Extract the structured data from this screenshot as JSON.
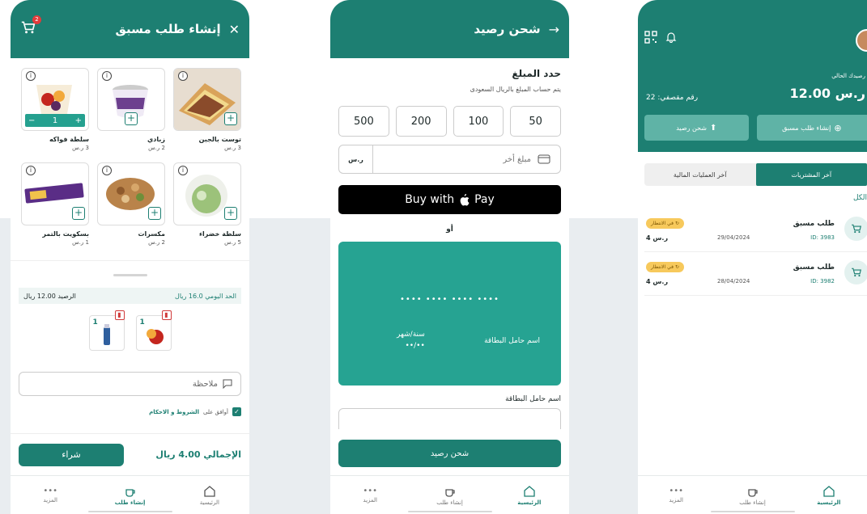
{
  "colors": {
    "primary": "#1d7f72",
    "card": "#26a392",
    "pending": "#f7c95c"
  },
  "nav": {
    "home": "الرئيسية",
    "create": "إنشاء طلب",
    "more": "المزيد"
  },
  "screen1": {
    "title": "إنشاء طلب مسبق",
    "cart_count": "2",
    "products": [
      {
        "name": "توست بالجبن",
        "price": "3 ر.س",
        "control": "add"
      },
      {
        "name": "زبادي",
        "price": "2 ر.س",
        "control": "add"
      },
      {
        "name": "سلطة فواكه",
        "price": "3 ر.س",
        "control": "stepper",
        "qty": "1"
      },
      {
        "name": "سلطة خضراء",
        "price": "5 ر.س",
        "control": "add"
      },
      {
        "name": "مكسرات",
        "price": "2 ر.س",
        "control": "add"
      },
      {
        "name": "بسكويت بالتمر",
        "price": "1 ر.س",
        "control": "add"
      }
    ],
    "daily_limit": "الحد اليومي 16.0 ريال",
    "balance": "الرصيد 12.00 ريال",
    "selected": [
      {
        "qty": "1"
      },
      {
        "qty": "1"
      }
    ],
    "note_placeholder": "ملاحظة",
    "terms_prefix": "أوافق على",
    "terms_link": "الشروط و الاحكام",
    "total": "الإجمالي 4.00 ريال",
    "buy": "شراء"
  },
  "screen2": {
    "title": "شحن رصيد",
    "heading": "حدد المبلغ",
    "subtitle": "يتم حساب المبلغ بالريال السعودى",
    "amounts": [
      "50",
      "100",
      "200",
      "500"
    ],
    "other_placeholder": "مبلغ أخر",
    "currency": "ر.س",
    "apple_pay": "Buy with",
    "apple_pay_word": "Pay",
    "or": "أو",
    "card_number": "•••• •••• •••• ••••",
    "card_holder": "اسم حامل البطاقة",
    "card_expiry_label": "سنة/شهر",
    "card_expiry": "••/••",
    "holder_label": "اسم حامل البطاقة",
    "submit": "شحن رصيد"
  },
  "screen3": {
    "balance_label": "رصيدك الحالي",
    "balance": "12.00 ر.س",
    "cafeteria_no": "رقم مقصفي: 22",
    "create_btn": "إنشاء طلب مسبق",
    "recharge_btn": "شحن رصيد",
    "tab_purchases": "آخر المشتريات",
    "tab_transactions": "آخر العمليات المالية",
    "filter_all": "الكل",
    "orders": [
      {
        "title": "طلب مسبق",
        "id": "ID: 3983",
        "date": "29/04/2024",
        "status": "في الانتظار",
        "amount": "4 ر.س"
      },
      {
        "title": "طلب مسبق",
        "id": "ID: 3982",
        "date": "28/04/2024",
        "status": "في الانتظار",
        "amount": "4 ر.س"
      }
    ]
  }
}
